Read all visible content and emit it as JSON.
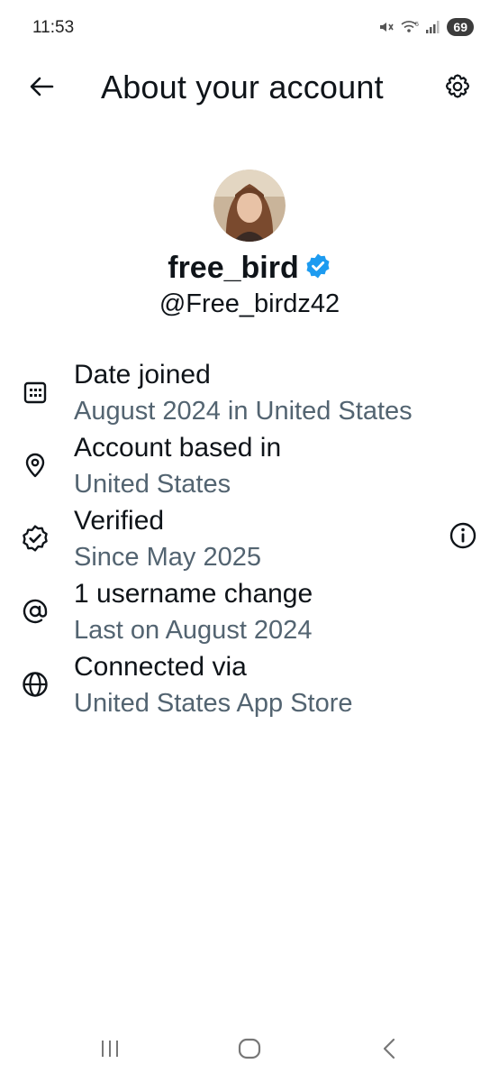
{
  "status_bar": {
    "time": "11:53",
    "battery": "69",
    "icons": [
      "mute-icon",
      "wifi-icon",
      "signal-icon",
      "battery-icon"
    ]
  },
  "header": {
    "title": "About your account",
    "back_icon": "arrow-left-icon",
    "settings_icon": "gear-icon"
  },
  "profile": {
    "display_name": "free_bird",
    "handle": "@Free_birdz42",
    "verified": true,
    "verified_color": "#1d9bf0"
  },
  "info": [
    {
      "icon": "calendar-icon",
      "title": "Date joined",
      "subtitle": "August 2024 in United States"
    },
    {
      "icon": "location-pin-icon",
      "title": "Account based in",
      "subtitle": "United States"
    },
    {
      "icon": "verified-badge-icon",
      "title": "Verified",
      "subtitle": "Since May 2025",
      "action_icon": "info-circle-icon"
    },
    {
      "icon": "at-sign-icon",
      "title": "1 username change",
      "subtitle": "Last on August 2024"
    },
    {
      "icon": "globe-icon",
      "title": "Connected via",
      "subtitle": "United States App Store"
    }
  ],
  "colors": {
    "text_primary": "#0f1419",
    "text_secondary": "#536471",
    "accent": "#1d9bf0"
  },
  "nav_bar": {
    "icons": [
      "recent-apps-icon",
      "home-icon",
      "back-icon"
    ]
  }
}
